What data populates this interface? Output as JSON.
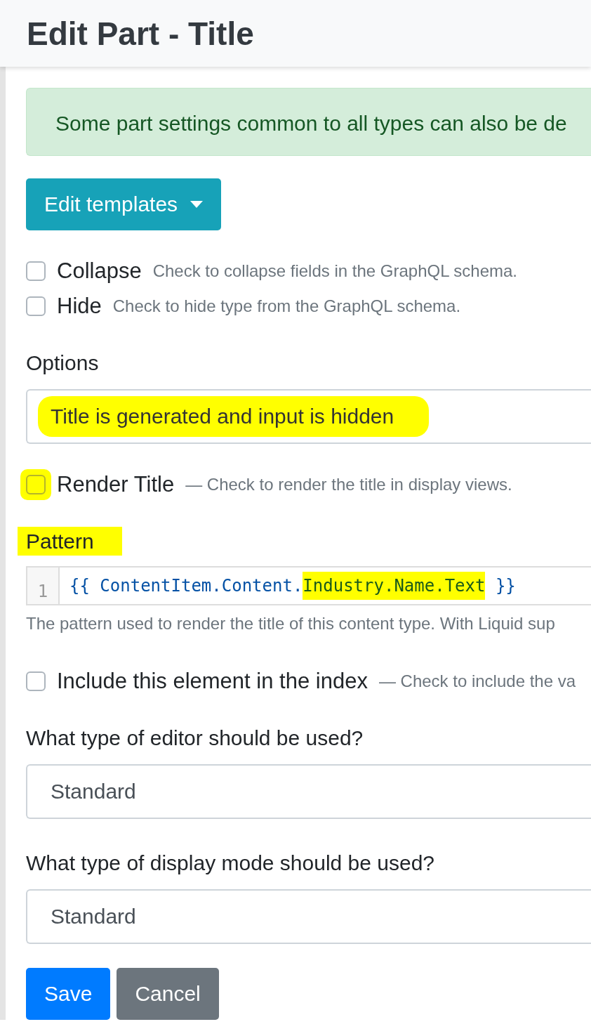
{
  "header": {
    "title": "Edit Part - Title"
  },
  "alert": {
    "text": "Some part settings common to all types can also be de"
  },
  "templates_button": {
    "label": "Edit templates"
  },
  "settings": [
    {
      "label": "Collapse",
      "hint": "Check to collapse fields in the GraphQL schema.",
      "checked": false
    },
    {
      "label": "Hide",
      "hint": "Check to hide type from the GraphQL schema.",
      "checked": false
    }
  ],
  "options": {
    "label": "Options",
    "value": "Title is generated and input is hidden",
    "highlighted": true
  },
  "render_title": {
    "label": "Render Title",
    "hint": "— Check to render the title in display views.",
    "checked": false,
    "highlighted": true
  },
  "pattern": {
    "label": "Pattern",
    "highlighted": true,
    "line_number": "1",
    "tokens": [
      {
        "text": "{{ ContentItem.Content.",
        "highlighted": false
      },
      {
        "text": "Industry.Name.Text",
        "highlighted": true
      },
      {
        "text": " }}",
        "highlighted": false
      }
    ],
    "hint": "The pattern used to render the title of this content type. With Liquid sup"
  },
  "index": {
    "label": "Include this element in the index",
    "hint": "— Check to include the va",
    "checked": false
  },
  "selects": [
    {
      "label": "What type of editor should be used?",
      "value": "Standard"
    },
    {
      "label": "What type of display mode should be used?",
      "value": "Standard"
    }
  ],
  "buttons": [
    {
      "label": "Save",
      "kind": "primary"
    },
    {
      "label": "Cancel",
      "kind": "secondary"
    }
  ]
}
